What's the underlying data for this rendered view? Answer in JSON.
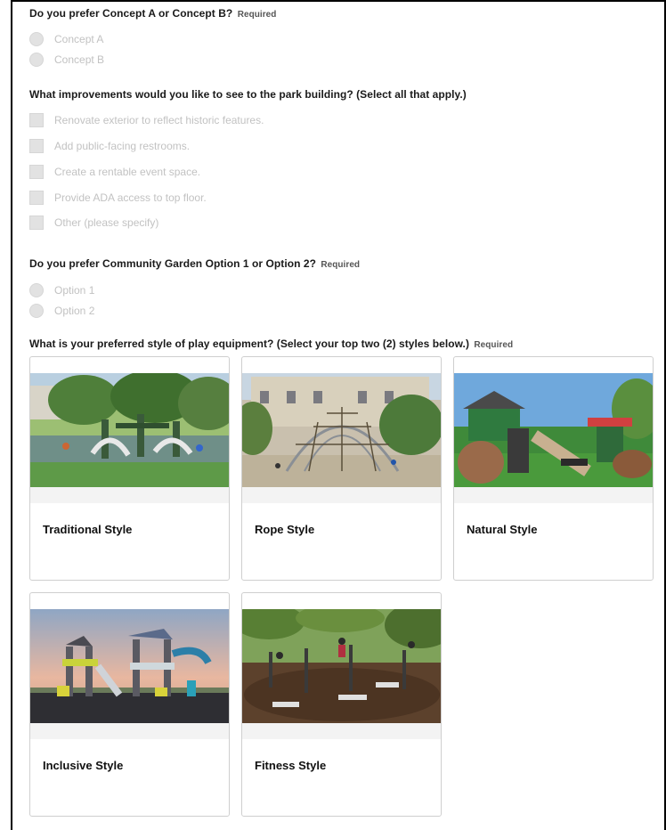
{
  "questions": {
    "concept": {
      "text": "Do you prefer Concept A or Concept B?",
      "required": "Required",
      "options": [
        "Concept A",
        "Concept B"
      ]
    },
    "building": {
      "text": "What improvements would you like to see to the park building? (Select all that apply.)",
      "options": [
        "Renovate exterior to reflect historic features.",
        "Add public-facing restrooms.",
        "Create a rentable event space.",
        "Provide ADA access to top floor.",
        "Other (please specify)"
      ]
    },
    "garden": {
      "text": "Do you prefer Community Garden Option 1 or Option 2?",
      "required": "Required",
      "options": [
        "Option 1",
        "Option 2"
      ]
    },
    "play": {
      "text": "What is your preferred style of play equipment? (Select your top two (2) styles below.)",
      "required": "Required",
      "cards": [
        {
          "title": "Traditional Style"
        },
        {
          "title": "Rope Style"
        },
        {
          "title": "Natural Style"
        },
        {
          "title": "Inclusive Style"
        },
        {
          "title": "Fitness Style"
        }
      ]
    }
  },
  "colors": {
    "option_text": "#c2c2c2",
    "control_fill": "#e2e2e2",
    "card_border": "#cfcfcf"
  }
}
